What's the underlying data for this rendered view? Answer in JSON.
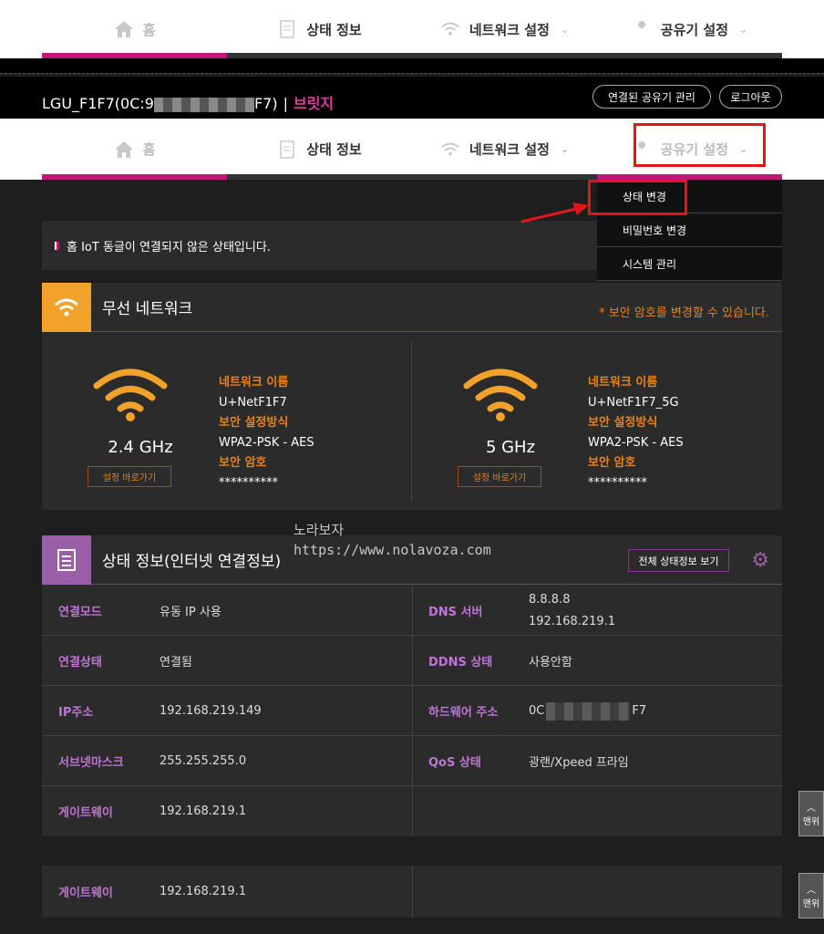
{
  "nav": {
    "tabs": [
      {
        "label": "홈",
        "icon": "home-icon"
      },
      {
        "label": "상태 정보",
        "icon": "document-icon"
      },
      {
        "label": "네트워크 설정",
        "icon": "wifi-icon"
      },
      {
        "label": "공유기 설정",
        "icon": "wrench-icon"
      }
    ]
  },
  "header": {
    "ssid_prefix": "LGU_F1F7(0C:9",
    "ssid_suffix": "F7)",
    "mode": "브릿지",
    "connected_btn": "연결된 공유기 관리",
    "logout_btn": "로그아웃"
  },
  "dropdown": {
    "items": [
      "상태 변경",
      "비밀번호 변경",
      "시스템 관리"
    ]
  },
  "notice": "홈 IoT 동글이 연결되지 않은 상태입니다.",
  "wireless": {
    "title": "무선 네트워크",
    "note": "* 보안 암호를 변경할 수 있습니다.",
    "bands": [
      {
        "freq": "2.4 GHz",
        "shortcut": "설정 바로가기",
        "name_label": "네트워크 이름",
        "name": "U+NetF1F7",
        "sec_label": "보안 설정방식",
        "sec": "WPA2-PSK - AES",
        "pw_label": "보안 암호",
        "pw": "**********"
      },
      {
        "freq": "5 GHz",
        "shortcut": "설정 바로가기",
        "name_label": "네트워크 이름",
        "name": "U+NetF1F7_5G",
        "sec_label": "보안 설정방식",
        "sec": "WPA2-PSK - AES",
        "pw_label": "보안 암호",
        "pw": "**********"
      }
    ]
  },
  "watermark": {
    "line1": "노라보자",
    "line2": "https://www.nolavoza.com"
  },
  "status": {
    "title": "상태 정보(인터넷 연결정보)",
    "all_btn": "전체 상태정보 보기",
    "rows": [
      {
        "k1": "연결모드",
        "v1": "유동 IP 사용",
        "k2": "DNS 서버",
        "v2": "8.8.8.8",
        "v2b": "192.168.219.1"
      },
      {
        "k1": "연결상태",
        "v1": "연결됨",
        "k2": "DDNS 상태",
        "v2": "사용안함"
      },
      {
        "k1": "IP주소",
        "v1": "192.168.219.149",
        "k2": "하드웨어 주소",
        "v2": "0C",
        "v2c": "F7"
      },
      {
        "k1": "서브넷마스크",
        "v1": "255.255.255.0",
        "k2": "QoS 상태",
        "v2": "광랜/Xpeed 프라임"
      },
      {
        "k1": "게이트웨이",
        "v1": "192.168.219.1"
      }
    ],
    "extra_row": {
      "k1": "게이트웨이",
      "v1": "192.168.219.1"
    }
  },
  "to_top": "맨위"
}
